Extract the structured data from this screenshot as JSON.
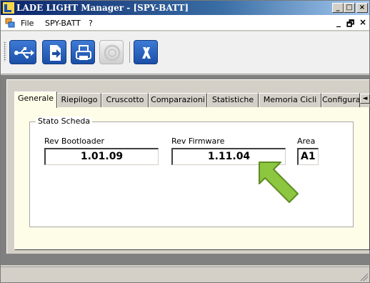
{
  "window": {
    "title": "LADE LIGHT Manager - [SPY-BATT]",
    "controls": {
      "minimize": "_",
      "maximize": "□",
      "close": "×"
    }
  },
  "menu": {
    "items": [
      {
        "label": "File"
      },
      {
        "label": "SPY-BATT"
      },
      {
        "label": "?"
      }
    ],
    "mdi_controls": {
      "minimize": "_",
      "restore": "🗗",
      "close": "×"
    }
  },
  "toolbar": {
    "buttons": [
      {
        "icon": "usb-icon",
        "enabled": true
      },
      {
        "icon": "export-icon",
        "enabled": true
      },
      {
        "icon": "print-icon",
        "enabled": true
      },
      {
        "icon": "record-icon",
        "enabled": false
      },
      {
        "icon": "cancel-icon",
        "enabled": true
      }
    ]
  },
  "tabs": [
    {
      "label": "Generale",
      "active": true
    },
    {
      "label": "Riepilogo",
      "active": false
    },
    {
      "label": "Cruscotto",
      "active": false
    },
    {
      "label": "Comparazioni",
      "active": false
    },
    {
      "label": "Statistiche",
      "active": false
    },
    {
      "label": "Memoria Cicli",
      "active": false
    },
    {
      "label": "Configura",
      "active": false
    }
  ],
  "tab_scroll": "◄",
  "stato_scheda": {
    "title": "Stato Scheda",
    "rev_bootloader": {
      "label": "Rev Bootloader",
      "value": "1.01.09"
    },
    "rev_firmware": {
      "label": "Rev Firmware",
      "value": "1.11.04"
    },
    "area": {
      "label": "Area",
      "value": "A1"
    }
  },
  "colors": {
    "tabpage_bg": "#fdfde8",
    "arrow": "#8dc63f",
    "toolbar_button": "#2a60c0"
  }
}
